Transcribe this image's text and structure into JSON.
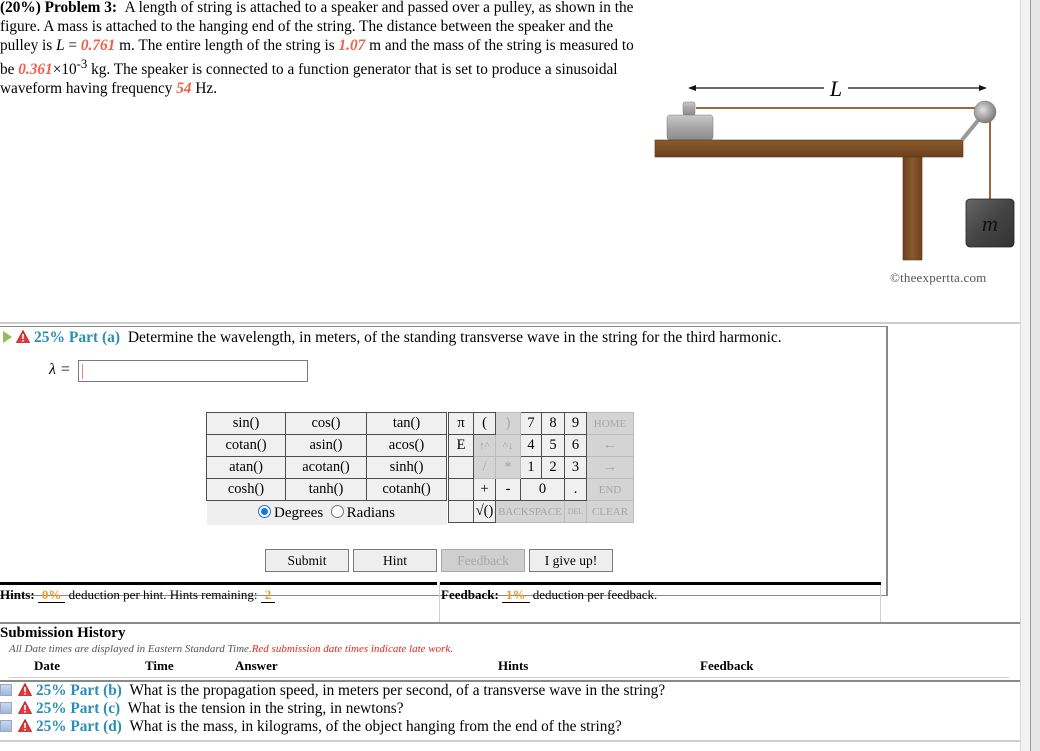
{
  "problem": {
    "weight": "(20%)",
    "label": "Problem 3:",
    "text_1": "A length of string is attached to a speaker and passed over a pulley, as shown in the figure. A mass is attached to the hanging end of the string. The distance between the speaker and the pulley is ",
    "L_symbol": "L",
    "eq": " = ",
    "L_value": "0.761",
    "text_2": " m. The entire length of the string is ",
    "length_value": "1.07",
    "text_3": " m and the mass of the string is measured to be ",
    "mass_value": "0.361",
    "mass_exp": "×10",
    "mass_sup": "-3",
    "text_4": " kg. The speaker is connected to a function generator that is set to produce a sinusoidal waveform having frequency ",
    "freq_value": "54",
    "text_5": " Hz."
  },
  "figure": {
    "L_label": "L",
    "mass_label": "m",
    "copyright": "©theexpertta.com"
  },
  "part_a": {
    "weight": "25% Part (a)",
    "question": "Determine the wavelength, in meters, of the standing transverse wave in the string for the third harmonic.",
    "answer_label": "λ =",
    "answer_value": ""
  },
  "func_keys": [
    [
      "sin()",
      "cos()",
      "tan()"
    ],
    [
      "cotan()",
      "asin()",
      "acos()"
    ],
    [
      "atan()",
      "acotan()",
      "sinh()"
    ],
    [
      "cosh()",
      "tanh()",
      "cotanh()"
    ]
  ],
  "angle_mode": {
    "degrees": "Degrees",
    "radians": "Radians",
    "selected": "Degrees"
  },
  "num_keys": {
    "pi": "π",
    "open_paren": "(",
    "close_paren": ")",
    "seven": "7",
    "eight": "8",
    "nine": "9",
    "home": "HOME",
    "e": "E",
    "up_caret": "↑^",
    "caret_down": "^↓",
    "four": "4",
    "five": "5",
    "six": "6",
    "left": "←",
    "slash": "/",
    "star": "*",
    "one": "1",
    "two": "2",
    "three": "3",
    "right": "→",
    "plus": "+",
    "minus": "-",
    "zero": "0",
    "dot": ".",
    "end": "END",
    "sqrt": "√()",
    "backspace": "BACKSPACE",
    "del": "DEL",
    "clear": "CLEAR"
  },
  "buttons": {
    "submit": "Submit",
    "hint": "Hint",
    "feedback": "Feedback",
    "give_up": "I give up!"
  },
  "hints": {
    "label": "Hints:",
    "deduction": "0%",
    "text": "deduction per hint. Hints remaining:",
    "remaining": "2"
  },
  "feedback": {
    "label": "Feedback:",
    "deduction": "1%",
    "text": "deduction per feedback."
  },
  "history": {
    "title": "Submission History",
    "note": "All Date times are displayed in Eastern Standard Time.",
    "late_note": "Red submission date times indicate late work.",
    "columns": [
      "Date",
      "Time",
      "Answer",
      "Hints",
      "Feedback"
    ]
  },
  "other_parts": [
    {
      "weight": "25% Part (b)",
      "question": "What is the propagation speed, in meters per second, of a transverse wave in the string?"
    },
    {
      "weight": "25% Part (c)",
      "question": "What is the tension in the string, in newtons?"
    },
    {
      "weight": "25% Part (d)",
      "question": "What is the mass, in kilograms, of the object hanging from the end of the string?"
    }
  ],
  "colors": {
    "given_value": "#f0604a",
    "part_label": "#2a8fb5",
    "hint_value": "#f39a1e",
    "late_note": "#e8251b",
    "radio_selected": "#1a73e8"
  }
}
